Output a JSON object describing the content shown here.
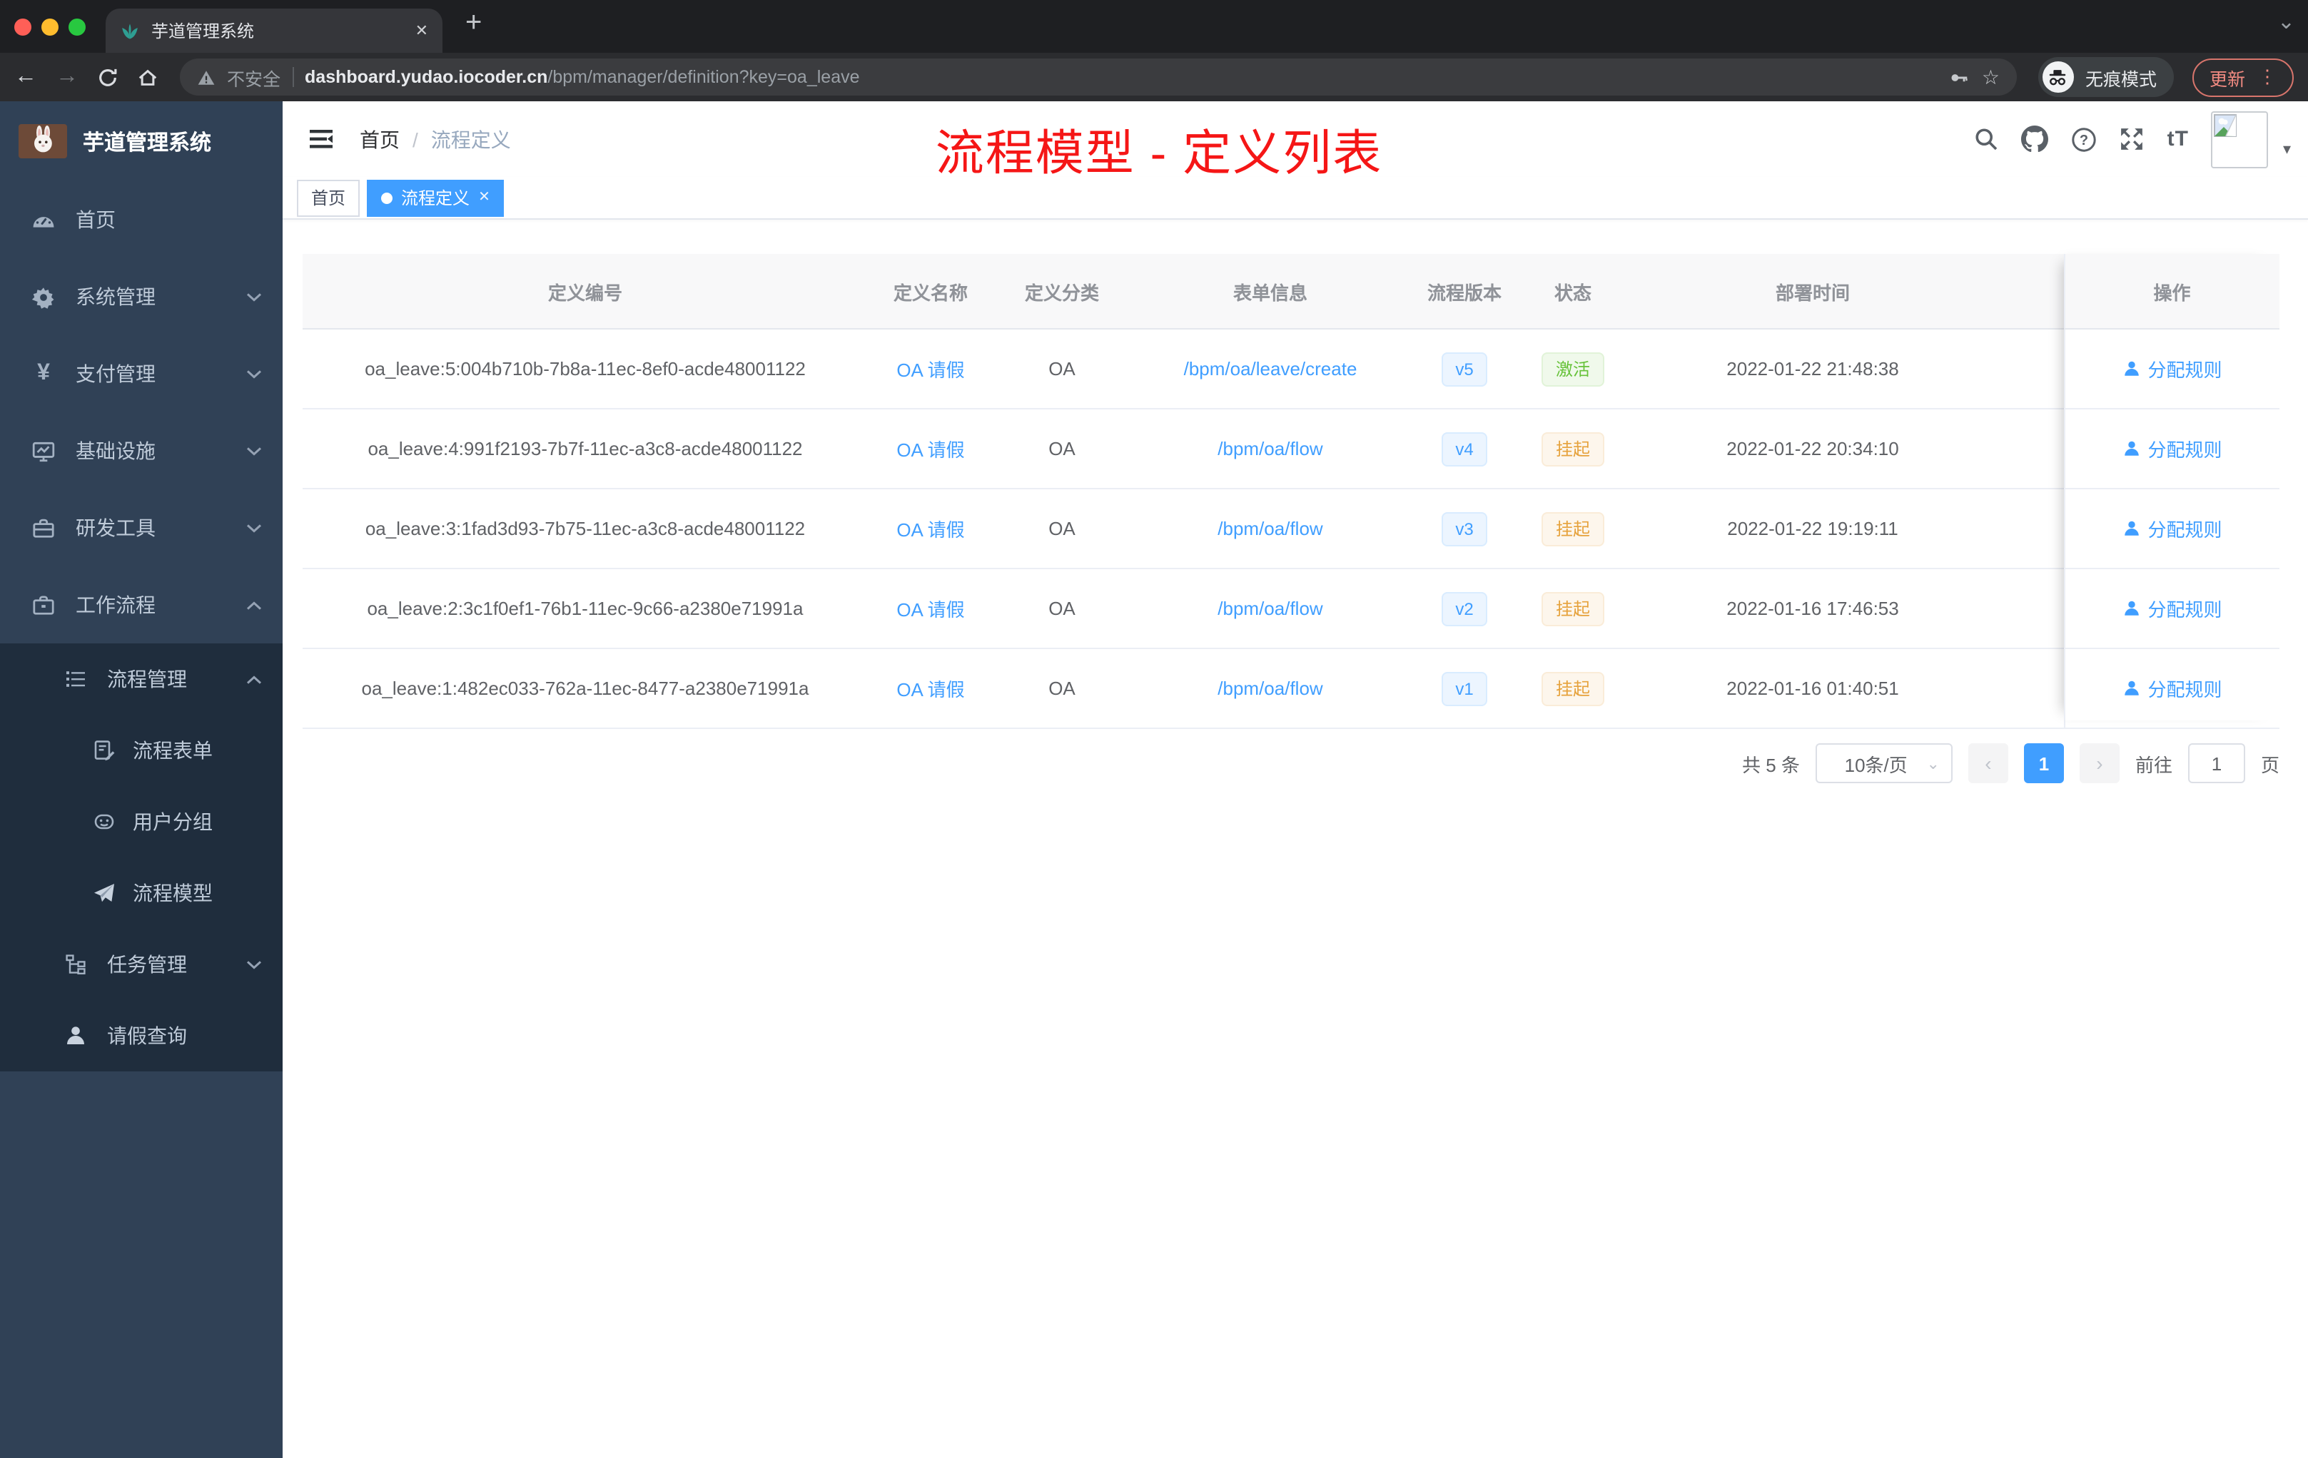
{
  "browser": {
    "tab": {
      "title": "芋道管理系统",
      "close_glyph": "✕",
      "new_tab_glyph": "+",
      "corner_caret_glyph": "⌄"
    },
    "toolbar": {
      "back_glyph": "←",
      "forward_glyph": "→",
      "security_warning": "不安全",
      "url_host": "dashboard.yudao.iocoder.cn",
      "url_path": "/bpm/manager/definition?key=oa_leave",
      "star_glyph": "☆",
      "incognito_label": "无痕模式",
      "update_label": "更新",
      "menu_dots_glyph": "⋮"
    }
  },
  "sidebar": {
    "brand": "芋道管理系统",
    "items": [
      {
        "label": "首页",
        "icon": "dashboard-icon"
      },
      {
        "label": "系统管理",
        "icon": "gear-icon"
      },
      {
        "label": "支付管理",
        "icon": "yen-icon",
        "yen_glyph": "¥"
      },
      {
        "label": "基础设施",
        "icon": "monitor-icon"
      },
      {
        "label": "研发工具",
        "icon": "toolbox-icon"
      },
      {
        "label": "工作流程",
        "icon": "briefcase-icon"
      }
    ],
    "submenu": [
      {
        "label": "流程管理",
        "icon": "list-icon"
      },
      {
        "label": "流程表单",
        "icon": "form-icon"
      },
      {
        "label": "用户分组",
        "icon": "robot-icon"
      },
      {
        "label": "流程模型",
        "icon": "send-icon"
      },
      {
        "label": "任务管理",
        "icon": "tree-icon"
      },
      {
        "label": "请假查询",
        "icon": "user-icon"
      }
    ]
  },
  "navbar": {
    "breadcrumb": {
      "home": "首页",
      "separator": "/",
      "current": "流程定义"
    },
    "overlay_title": "流程模型 - 定义列表",
    "font_size_button": "tT"
  },
  "tags": [
    {
      "label": "首页"
    },
    {
      "label": "流程定义",
      "close_glyph": "✕"
    }
  ],
  "table": {
    "columns": [
      "定义编号",
      "定义名称",
      "定义分类",
      "表单信息",
      "流程版本",
      "状态",
      "部署时间",
      "操作"
    ],
    "action_label": "分配规则",
    "rows": [
      {
        "id": "oa_leave:5:004b710b-7b8a-11ec-8ef0-acde48001122",
        "name": "OA 请假",
        "category": "OA",
        "form": "/bpm/oa/leave/create",
        "version": "v5",
        "status": "激活",
        "status_type": "success",
        "time": "2022-01-22 21:48:38"
      },
      {
        "id": "oa_leave:4:991f2193-7b7f-11ec-a3c8-acde48001122",
        "name": "OA 请假",
        "category": "OA",
        "form": "/bpm/oa/flow",
        "version": "v4",
        "status": "挂起",
        "status_type": "warning",
        "time": "2022-01-22 20:34:10"
      },
      {
        "id": "oa_leave:3:1fad3d93-7b75-11ec-a3c8-acde48001122",
        "name": "OA 请假",
        "category": "OA",
        "form": "/bpm/oa/flow",
        "version": "v3",
        "status": "挂起",
        "status_type": "warning",
        "time": "2022-01-22 19:19:11"
      },
      {
        "id": "oa_leave:2:3c1f0ef1-76b1-11ec-9c66-a2380e71991a",
        "name": "OA 请假",
        "category": "OA",
        "form": "/bpm/oa/flow",
        "version": "v2",
        "status": "挂起",
        "status_type": "warning",
        "time": "2022-01-16 17:46:53"
      },
      {
        "id": "oa_leave:1:482ec033-762a-11ec-8477-a2380e71991a",
        "name": "OA 请假",
        "category": "OA",
        "form": "/bpm/oa/flow",
        "version": "v1",
        "status": "挂起",
        "status_type": "warning",
        "time": "2022-01-16 01:40:51"
      }
    ]
  },
  "pagination": {
    "total": "共 5 条",
    "page_size": "10条/页",
    "prev_glyph": "‹",
    "page": "1",
    "next_glyph": "›",
    "goto_label": "前往",
    "goto_value": "1",
    "unit": "页",
    "select_caret_glyph": "⌄"
  },
  "colors": {
    "accent": "#409eff",
    "success": "#67c23a",
    "warning": "#e6a23c",
    "sidebar_bg": "#304156",
    "submenu_bg": "#1f2d3d",
    "overlay_title": "#f51616"
  }
}
